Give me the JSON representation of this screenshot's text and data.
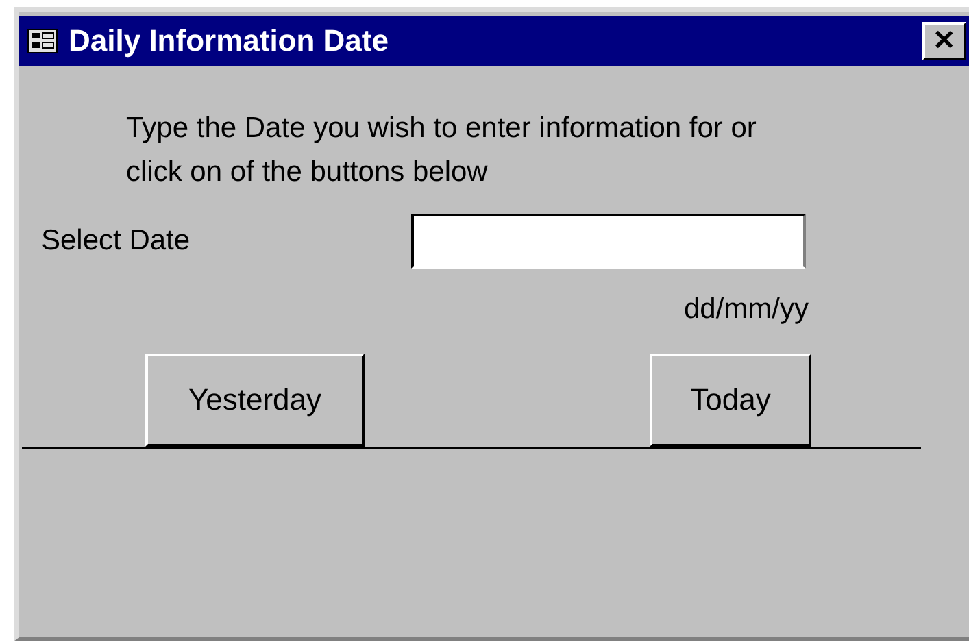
{
  "window": {
    "title": "Daily Information Date",
    "close": "✕"
  },
  "instructions": "Type the Date you wish to enter information for or click on of the buttons below",
  "date_field": {
    "label": "Select Date",
    "hint": "dd/mm/yy"
  },
  "buttons": [
    "Yesterday",
    "Today"
  ]
}
